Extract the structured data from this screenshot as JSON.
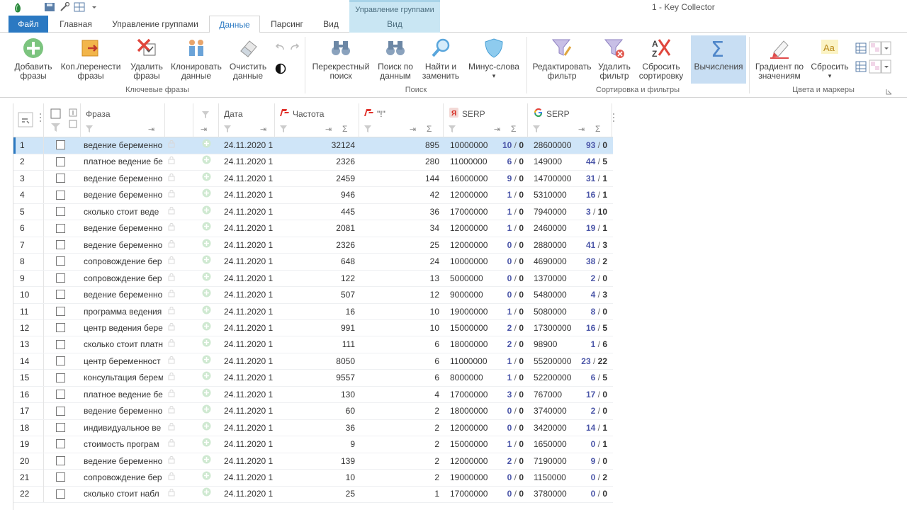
{
  "title": {
    "window_title": "1 - Key Collector",
    "context_group": "Управление группами"
  },
  "tabs": [
    {
      "id": "file",
      "label": "Файл"
    },
    {
      "id": "home",
      "label": "Главная"
    },
    {
      "id": "group",
      "label": "Управление группами"
    },
    {
      "id": "data",
      "label": "Данные"
    },
    {
      "id": "parsing",
      "label": "Парсинг"
    },
    {
      "id": "view",
      "label": "Вид"
    },
    {
      "id": "view2",
      "label": "Вид"
    }
  ],
  "ribbon": {
    "buttons": {
      "add": "Добавить фразы",
      "copy_move": "Коп./перенести фразы",
      "delete": "Удалить фразы",
      "clone": "Клонировать данные",
      "clear": "Очистить данные",
      "cross_search": "Перекрестный поиск",
      "data_search": "Поиск по данным",
      "find_replace": "Найти и заменить",
      "minus_words": "Минус-слова",
      "edit_filter": "Редактировать фильтр",
      "delete_filter": "Удалить фильтр",
      "reset_sort": "Сбросить сортировку",
      "calc": "Вычисления",
      "gradient": "Градиент по значениям",
      "reset": "Сбросить"
    },
    "groups": {
      "keywords": "Ключевые фразы",
      "search": "Поиск",
      "sort_filters": "Сортировка и фильтры",
      "colors": "Цвета и маркеры"
    }
  },
  "grid": {
    "headers": {
      "phrase": "Фраза",
      "date": "Дата",
      "freq": "Частота",
      "excl": "\"!\"",
      "ya_serp": "SERP",
      "g_serp": "SERP"
    },
    "rows": [
      {
        "n": "1",
        "phrase": "ведение беременно",
        "date": "24.11.2020 1",
        "freq": "32124",
        "excl": "895",
        "ya": "10000000",
        "ya_a": "10",
        "ya_b": "0",
        "g": "28600000",
        "g_a": "93",
        "g_b": "0"
      },
      {
        "n": "2",
        "phrase": "платное ведение бе",
        "date": "24.11.2020 1",
        "freq": "2326",
        "excl": "280",
        "ya": "11000000",
        "ya_a": "6",
        "ya_b": "0",
        "g": "149000",
        "g_a": "44",
        "g_b": "5"
      },
      {
        "n": "3",
        "phrase": "ведение беременно",
        "date": "24.11.2020 1",
        "freq": "2459",
        "excl": "144",
        "ya": "16000000",
        "ya_a": "9",
        "ya_b": "0",
        "g": "14700000",
        "g_a": "31",
        "g_b": "1"
      },
      {
        "n": "4",
        "phrase": "ведение беременно",
        "date": "24.11.2020 1",
        "freq": "946",
        "excl": "42",
        "ya": "12000000",
        "ya_a": "1",
        "ya_b": "0",
        "g": "5310000",
        "g_a": "16",
        "g_b": "1"
      },
      {
        "n": "5",
        "phrase": "сколько стоит веде",
        "date": "24.11.2020 1",
        "freq": "445",
        "excl": "36",
        "ya": "17000000",
        "ya_a": "1",
        "ya_b": "0",
        "g": "7940000",
        "g_a": "3",
        "g_b": "10"
      },
      {
        "n": "6",
        "phrase": "ведение беременно",
        "date": "24.11.2020 1",
        "freq": "2081",
        "excl": "34",
        "ya": "12000000",
        "ya_a": "1",
        "ya_b": "0",
        "g": "2460000",
        "g_a": "19",
        "g_b": "1"
      },
      {
        "n": "7",
        "phrase": "ведение беременно",
        "date": "24.11.2020 1",
        "freq": "2326",
        "excl": "25",
        "ya": "12000000",
        "ya_a": "0",
        "ya_b": "0",
        "g": "2880000",
        "g_a": "41",
        "g_b": "3"
      },
      {
        "n": "8",
        "phrase": "сопровождение бер",
        "date": "24.11.2020 1",
        "freq": "648",
        "excl": "24",
        "ya": "10000000",
        "ya_a": "0",
        "ya_b": "0",
        "g": "4690000",
        "g_a": "38",
        "g_b": "2"
      },
      {
        "n": "9",
        "phrase": "сопровождение бер",
        "date": "24.11.2020 1",
        "freq": "122",
        "excl": "13",
        "ya": "5000000",
        "ya_a": "0",
        "ya_b": "0",
        "g": "1370000",
        "g_a": "2",
        "g_b": "0"
      },
      {
        "n": "10",
        "phrase": "ведение беременно",
        "date": "24.11.2020 1",
        "freq": "507",
        "excl": "12",
        "ya": "9000000",
        "ya_a": "0",
        "ya_b": "0",
        "g": "5480000",
        "g_a": "4",
        "g_b": "3"
      },
      {
        "n": "11",
        "phrase": "программа ведения",
        "date": "24.11.2020 1",
        "freq": "16",
        "excl": "10",
        "ya": "19000000",
        "ya_a": "1",
        "ya_b": "0",
        "g": "5080000",
        "g_a": "8",
        "g_b": "0"
      },
      {
        "n": "12",
        "phrase": "центр ведения бере",
        "date": "24.11.2020 1",
        "freq": "991",
        "excl": "10",
        "ya": "15000000",
        "ya_a": "2",
        "ya_b": "0",
        "g": "17300000",
        "g_a": "16",
        "g_b": "5"
      },
      {
        "n": "13",
        "phrase": "сколько стоит платн",
        "date": "24.11.2020 1",
        "freq": "111",
        "excl": "6",
        "ya": "18000000",
        "ya_a": "2",
        "ya_b": "0",
        "g": "98900",
        "g_a": "1",
        "g_b": "6"
      },
      {
        "n": "14",
        "phrase": "центр беременност",
        "date": "24.11.2020 1",
        "freq": "8050",
        "excl": "6",
        "ya": "11000000",
        "ya_a": "1",
        "ya_b": "0",
        "g": "55200000",
        "g_a": "23",
        "g_b": "22"
      },
      {
        "n": "15",
        "phrase": "консультация берем",
        "date": "24.11.2020 1",
        "freq": "9557",
        "excl": "6",
        "ya": "8000000",
        "ya_a": "1",
        "ya_b": "0",
        "g": "52200000",
        "g_a": "6",
        "g_b": "5"
      },
      {
        "n": "16",
        "phrase": "платное ведение бе",
        "date": "24.11.2020 1",
        "freq": "130",
        "excl": "4",
        "ya": "17000000",
        "ya_a": "3",
        "ya_b": "0",
        "g": "767000",
        "g_a": "17",
        "g_b": "0"
      },
      {
        "n": "17",
        "phrase": "ведение беременно",
        "date": "24.11.2020 1",
        "freq": "60",
        "excl": "2",
        "ya": "18000000",
        "ya_a": "0",
        "ya_b": "0",
        "g": "3740000",
        "g_a": "2",
        "g_b": "0"
      },
      {
        "n": "18",
        "phrase": "индивидуальное ве",
        "date": "24.11.2020 1",
        "freq": "36",
        "excl": "2",
        "ya": "12000000",
        "ya_a": "0",
        "ya_b": "0",
        "g": "3420000",
        "g_a": "14",
        "g_b": "1"
      },
      {
        "n": "19",
        "phrase": "стоимость програм",
        "date": "24.11.2020 1",
        "freq": "9",
        "excl": "2",
        "ya": "15000000",
        "ya_a": "1",
        "ya_b": "0",
        "g": "1650000",
        "g_a": "0",
        "g_b": "1"
      },
      {
        "n": "20",
        "phrase": "ведение беременно",
        "date": "24.11.2020 1",
        "freq": "139",
        "excl": "2",
        "ya": "12000000",
        "ya_a": "2",
        "ya_b": "0",
        "g": "7190000",
        "g_a": "9",
        "g_b": "0"
      },
      {
        "n": "21",
        "phrase": "сопровождение бер",
        "date": "24.11.2020 1",
        "freq": "10",
        "excl": "2",
        "ya": "19000000",
        "ya_a": "0",
        "ya_b": "0",
        "g": "1150000",
        "g_a": "0",
        "g_b": "2"
      },
      {
        "n": "22",
        "phrase": "сколько стоит набл",
        "date": "24.11.2020 1",
        "freq": "25",
        "excl": "1",
        "ya": "17000000",
        "ya_a": "0",
        "ya_b": "0",
        "g": "3780000",
        "g_a": "0",
        "g_b": "0"
      }
    ],
    "selected_row": "1"
  },
  "colors": {
    "accent": "#2b79c2",
    "selection": "#cfe5f8",
    "position_blue": "#4b56a8"
  }
}
